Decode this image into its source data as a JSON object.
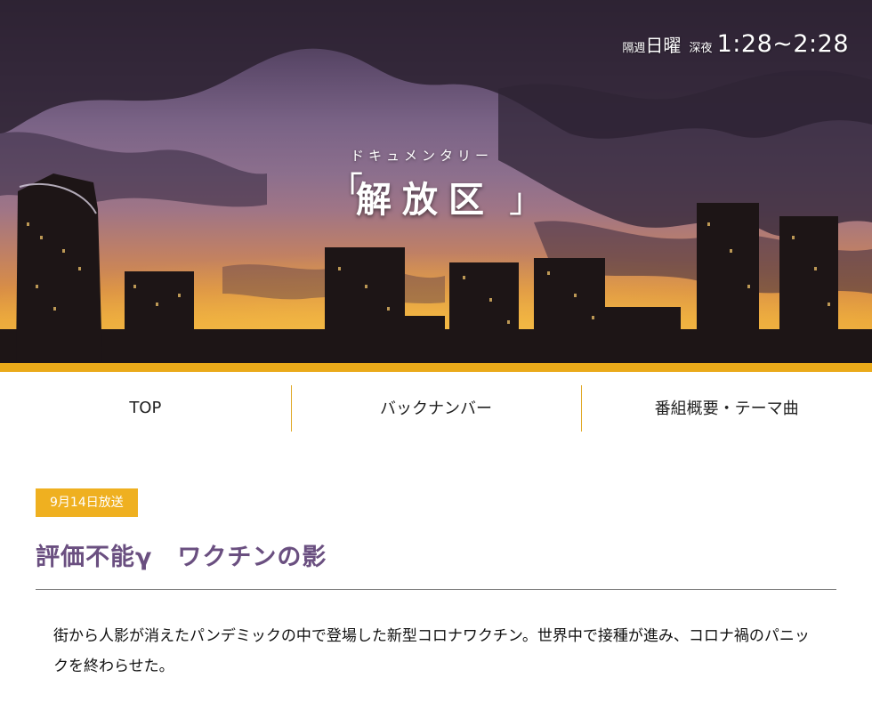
{
  "hero": {
    "schedule_every_other": "隔週",
    "schedule_day": "日曜",
    "schedule_late_night": "深夜",
    "schedule_time": "1:28~2:28",
    "logo_kana": "ドキュメンタリー",
    "logo_bracket_open": "「",
    "logo_title": "解放区",
    "logo_bracket_close": "」"
  },
  "nav": {
    "items": [
      {
        "label": "TOP"
      },
      {
        "label": "バックナンバー"
      },
      {
        "label": "番組概要・テーマ曲"
      }
    ]
  },
  "article": {
    "broadcast_date": "9月14日放送",
    "title": "評価不能γ　ワクチンの影",
    "body": "街から人影が消えたパンデミックの中で登場した新型コロナワクチン。世界中で接種が進み、コロナ禍のパニックを終わらせた。"
  },
  "colors": {
    "accent": "#eaaa1a",
    "title": "#6a4f80",
    "nav_divider": "#e0a825"
  }
}
